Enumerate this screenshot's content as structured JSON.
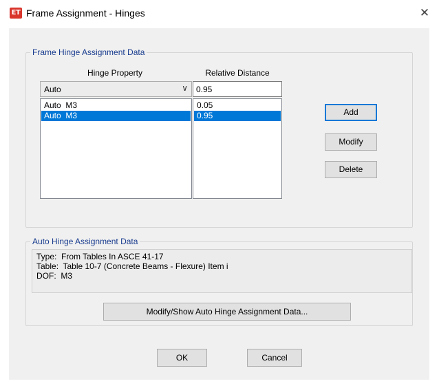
{
  "window": {
    "icon_text": "ET",
    "title": "Frame Assignment - Hinges",
    "close_glyph": "✕"
  },
  "frame_hinge_group": {
    "label": "Frame Hinge Assignment Data",
    "hinge_property_header": "Hinge Property",
    "relative_distance_header": "Relative Distance",
    "hinge_property_select": {
      "value": "Auto",
      "arrow": "∨"
    },
    "relative_distance_input": {
      "value": "0.95"
    },
    "hinge_list": [
      {
        "label": "Auto  M3",
        "selected": false
      },
      {
        "label": "Auto  M3",
        "selected": true
      }
    ],
    "distance_list": [
      {
        "label": "0.05",
        "selected": false
      },
      {
        "label": "0.95",
        "selected": true
      }
    ],
    "buttons": {
      "add": "Add",
      "modify": "Modify",
      "delete": "Delete"
    }
  },
  "auto_hinge_group": {
    "label": "Auto Hinge Assignment Data",
    "lines": [
      "Type:  From Tables In ASCE 41-17",
      "Table:  Table 10-7 (Concrete Beams - Flexure) Item i",
      "DOF:  M3"
    ],
    "modify_show_button": "Modify/Show Auto Hinge Assignment Data..."
  },
  "footer": {
    "ok": "OK",
    "cancel": "Cancel"
  },
  "colors": {
    "accent": "#0078d7",
    "group_label": "#1a3d8f",
    "icon_bg": "#d9352b",
    "dialog_bg": "#f0f0f0"
  }
}
